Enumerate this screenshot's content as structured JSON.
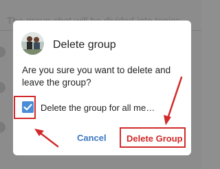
{
  "background": {
    "text": "The group chat will be divided into topics"
  },
  "dialog": {
    "title": "Delete group",
    "message": "Are you sure you want to delete and leave the group?",
    "checkbox_label": "Delete the group for all me…",
    "checkbox_checked": true,
    "cancel_label": "Cancel",
    "delete_label": "Delete Group"
  },
  "colors": {
    "accent": "#3b79c2",
    "checkbox": "#4a8cd6",
    "annotation": "#d12a2a"
  },
  "icons": {
    "checkbox": "check-icon",
    "avatar": "group-avatar-photo"
  }
}
